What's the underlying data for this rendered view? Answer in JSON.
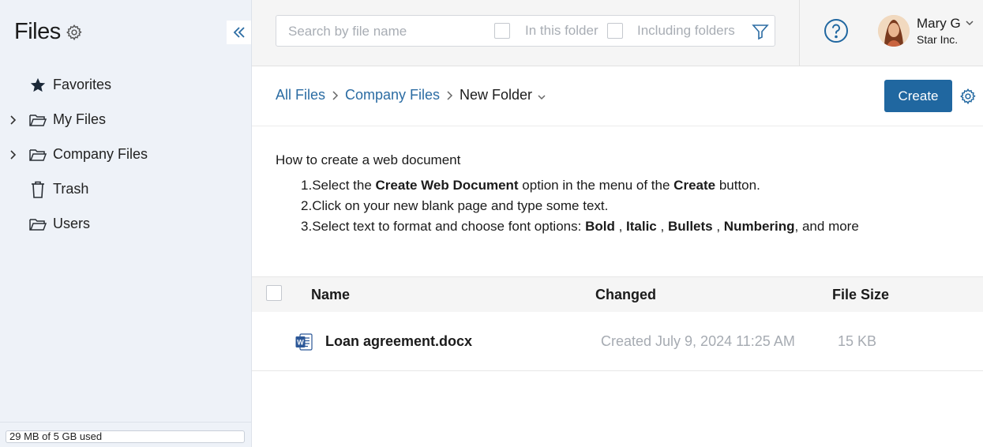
{
  "sidebar": {
    "title": "Files",
    "items": [
      {
        "label": "Favorites",
        "icon": "star-icon",
        "expandable": false
      },
      {
        "label": "My Files",
        "icon": "folder-icon",
        "expandable": true
      },
      {
        "label": "Company Files",
        "icon": "folder-icon",
        "expandable": true
      },
      {
        "label": "Trash",
        "icon": "trash-icon",
        "expandable": false
      },
      {
        "label": "Users",
        "icon": "folder-icon",
        "expandable": false
      }
    ],
    "quota": "29 MB of 5 GB used"
  },
  "topbar": {
    "search_placeholder": "Search by file name",
    "in_this_folder": "In this folder",
    "including_folders": "Including folders",
    "user_name": "Mary G",
    "company": "Star Inc."
  },
  "breadcrumb": {
    "items": [
      "All Files",
      "Company Files",
      "New Folder"
    ],
    "create_label": "Create"
  },
  "howto": {
    "title": "How to create a web document",
    "step1": {
      "num": "1.",
      "a": "Select the ",
      "b": "Create Web Document",
      "c": " option in the menu of the ",
      "d": "Create",
      "e": " button."
    },
    "step2": {
      "num": "2.",
      "text": "Click on your new blank page and type some text."
    },
    "step3": {
      "num": "3.",
      "a": "Select text to format and choose font options: ",
      "b": "Bold",
      "c": " , ",
      "d": "Italic",
      "e": " , ",
      "f": "Bullets",
      "g": " , ",
      "h": "Numbering",
      "i": ", and more"
    }
  },
  "table": {
    "headers": {
      "name": "Name",
      "changed": "Changed",
      "size": "File Size"
    },
    "rows": [
      {
        "name": "Loan agreement.docx",
        "changed": "Created July 9, 2024 11:25 AM",
        "size": "15 KB",
        "icon": "word-doc-icon"
      }
    ]
  },
  "colors": {
    "accent": "#2067a0",
    "link": "#2b6ca3",
    "sidebar_bg": "#eef2f8"
  }
}
